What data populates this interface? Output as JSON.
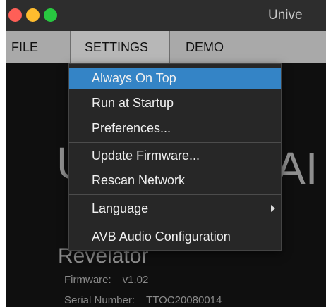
{
  "window": {
    "title": "Unive"
  },
  "menubar": {
    "file": "FILE",
    "settings": "SETTINGS",
    "demo": "DEMO"
  },
  "settings_menu": {
    "items": [
      {
        "label": "Always On Top"
      },
      {
        "label": "Run at Startup"
      },
      {
        "label": "Preferences..."
      },
      {
        "label": "Update Firmware..."
      },
      {
        "label": "Rescan Network"
      },
      {
        "label": "Language"
      },
      {
        "label": "AVB Audio Configuration"
      }
    ]
  },
  "background": {
    "partial_left": "U",
    "partial_right": "AI"
  },
  "device": {
    "name": "Revelator",
    "firmware_label": "Firmware:",
    "firmware_value": "v1.02",
    "serial_label": "Serial Number:",
    "serial_value": "TTOC20080014"
  }
}
